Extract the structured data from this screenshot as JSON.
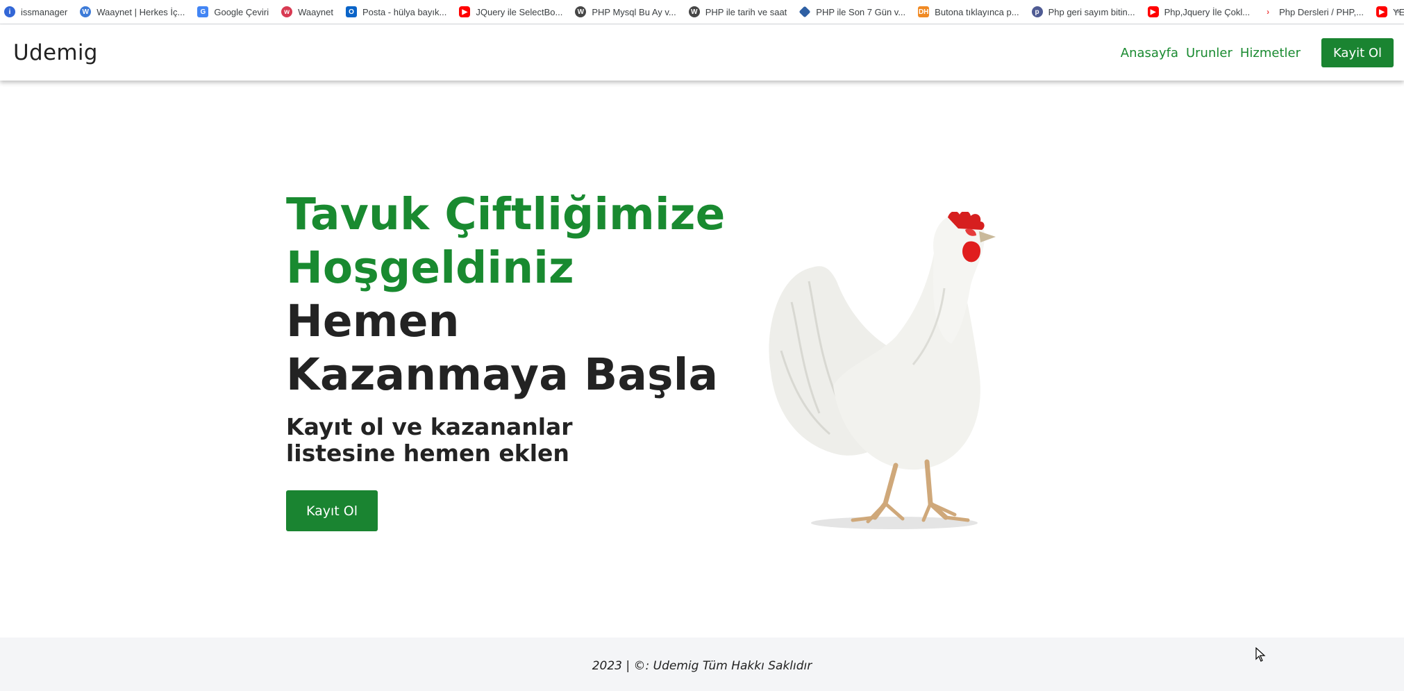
{
  "bookmarks": [
    {
      "label": "issmanager",
      "icon": "is"
    },
    {
      "label": "Waaynet | Herkes İç...",
      "icon": "wy"
    },
    {
      "label": "Google Çeviri",
      "icon": "gt"
    },
    {
      "label": "Waaynet",
      "icon": "wn"
    },
    {
      "label": "Posta - hülya bayık...",
      "icon": "ol"
    },
    {
      "label": "JQuery ile SelectBo...",
      "icon": "yt"
    },
    {
      "label": "PHP Mysql Bu Ay v...",
      "icon": "wp"
    },
    {
      "label": "PHP ile tarih ve saat",
      "icon": "wp"
    },
    {
      "label": "PHP ile Son 7 Gün v...",
      "icon": "sd"
    },
    {
      "label": "Butona tıklayınca p...",
      "icon": "dh"
    },
    {
      "label": "Php geri sayım bitin...",
      "icon": "php"
    },
    {
      "label": "Php,Jquery İle Çokl...",
      "icon": "yt"
    },
    {
      "label": "Php Dersleri / PHP,...",
      "icon": "pd"
    },
    {
      "label": "YENİ Proje Cari Hes...",
      "icon": "yt"
    }
  ],
  "bookmarks_more": "»",
  "navbar": {
    "brand": "Udemig",
    "links": [
      "Anasayfa",
      "Urunler",
      "Hizmetler"
    ],
    "button": "Kayit Ol"
  },
  "hero": {
    "title_green_1": "Tavuk Çiftliğimize",
    "title_green_2": "Hoşgeldiniz",
    "title_dark_1": "Hemen",
    "title_dark_2": "Kazanmaya Başla",
    "subtitle": "Kayıt ol ve kazananlar listesine hemen eklen",
    "button": "Kayıt Ol"
  },
  "footer": {
    "text": "2023 | ©: Udemig Tüm Hakkı Saklıdır"
  },
  "colors": {
    "brand_green": "#198a30",
    "button_green": "#1a8431",
    "footer_bg": "#f4f5f7"
  }
}
